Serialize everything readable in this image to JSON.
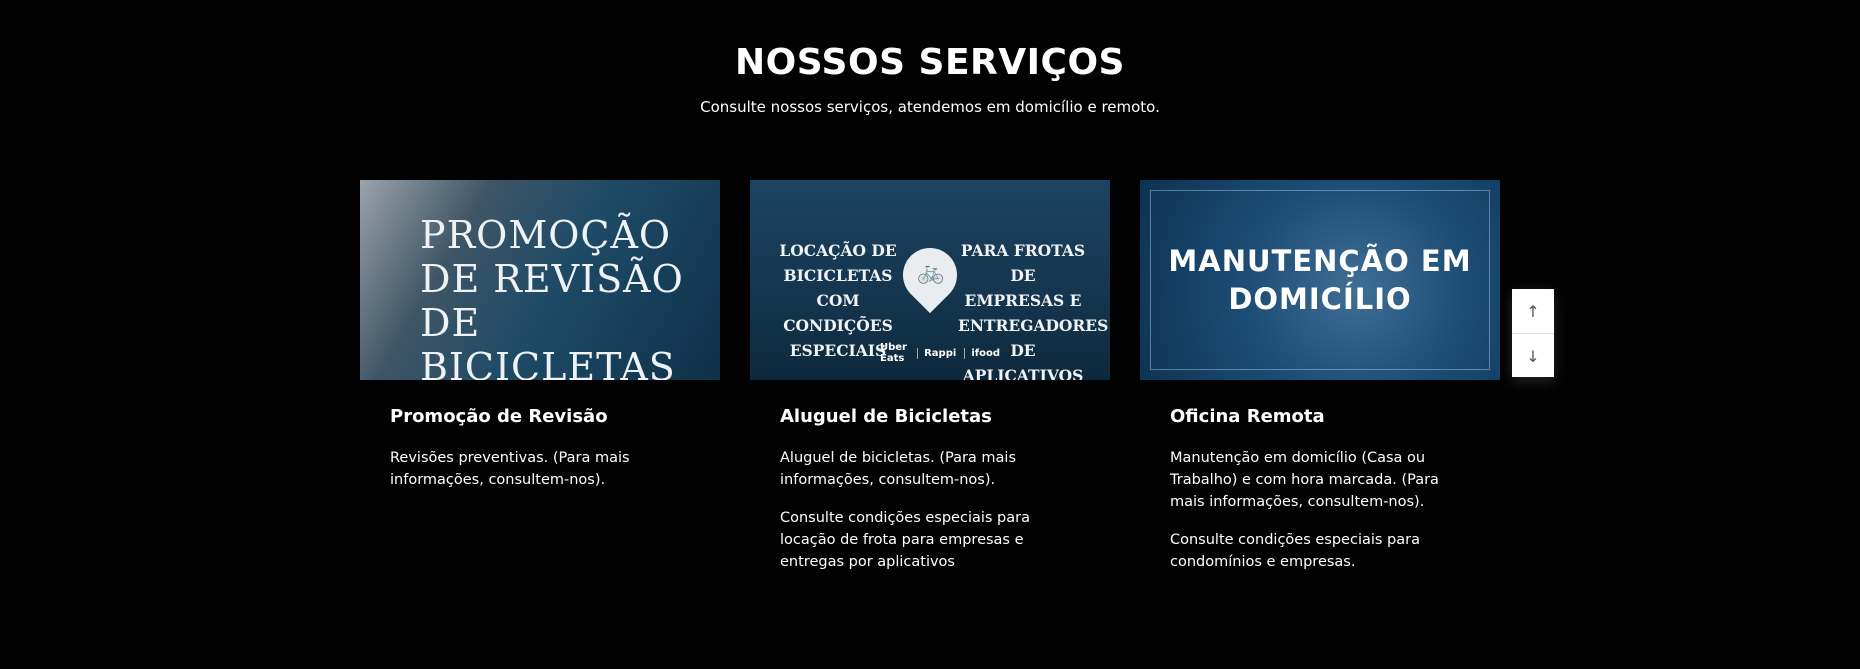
{
  "section": {
    "title": "NOSSOS SERVIÇOS",
    "subtitle": "Consulte nossos serviços, atendemos em domicílio e remoto."
  },
  "cards": [
    {
      "image_text": "PROMOÇÃO DE REVISÃO DE BICICLETAS",
      "title": "Promoção de Revisão",
      "paragraphs": [
        "Revisões preventivas. (Para mais informações, consultem-nos)."
      ]
    },
    {
      "image_left_text": "LOCAÇÃO DE BICICLETAS COM CONDIÇÕES ESPECIAIS",
      "image_right_text": "PARA FROTAS DE EMPRESAS E ENTREGADORES DE APLICATIVOS",
      "image_logos": [
        "Uber Eats",
        "Rappi",
        "ifood"
      ],
      "title": "Aluguel de Bicicletas",
      "paragraphs": [
        "Aluguel de bicicletas. (Para mais informações, consultem-nos).",
        "Consulte condições especiais para locação de frota para empresas e entregas por aplicativos"
      ]
    },
    {
      "image_text": "MANUTENÇÃO EM DOMICÍLIO",
      "title": "Oficina Remota",
      "paragraphs": [
        "Manutenção em domicílio (Casa ou Trabalho) e com hora marcada. (Para mais informações, consultem-nos).",
        "Consulte condições especiais para condomínios e empresas."
      ]
    }
  ],
  "scroll_controls": {
    "up_icon": "↑",
    "down_icon": "↓"
  },
  "icons": {
    "pin": "bicycle-pin-icon",
    "up": "arrow-up-icon",
    "down": "arrow-down-icon"
  },
  "colors": {
    "background": "#020203",
    "text": "#ffffff",
    "image_blue": "#1a4a6a"
  }
}
